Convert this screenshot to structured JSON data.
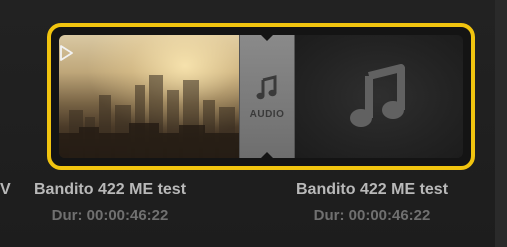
{
  "media_pool": {
    "clips": [
      {
        "name": "Bandito 422 ME test",
        "duration": "Dur: 00:00:46:22",
        "selected": true
      },
      {
        "name": "Bandito 422 ME test",
        "duration": "Dur: 00:00:46:22",
        "selected": false
      }
    ],
    "partial_left_clip_name": "V",
    "audio_badge": "AUDIO",
    "icons": {
      "play": "play-icon",
      "audio_small": "music-note-icon",
      "audio_large": "music-note-icon"
    },
    "colors": {
      "selection_border": "#f1c40f",
      "background": "#1f1f1f",
      "clip_name": "#b9b9b9",
      "clip_duration": "#707070"
    }
  }
}
